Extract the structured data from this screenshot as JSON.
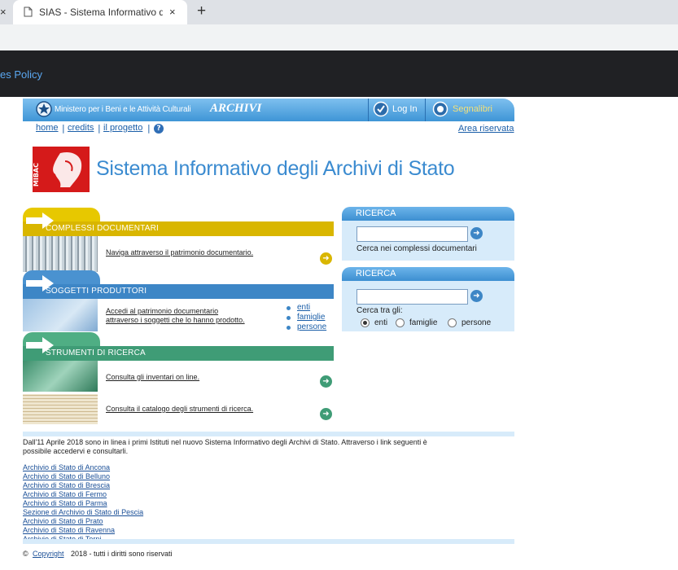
{
  "browser": {
    "close_left": "×",
    "tab_title": "SIAS - Sistema Informativo degli",
    "tab_close": "×",
    "new_tab": "+",
    "banner_text": "es Policy"
  },
  "header": {
    "ministry": "Ministero per i Beni e le Attività Culturali",
    "archivi": "ARCHIVI",
    "login": "Log In",
    "bookmarks": "Segnalibri"
  },
  "subnav": {
    "home": "home",
    "credits": "credits",
    "progetto": "il progetto",
    "sep": "|",
    "help": "?",
    "reserved": "Area riservata"
  },
  "logo": {
    "mark": "MIBAC",
    "title": "Sistema Informativo degli Archivi di Stato"
  },
  "sections": {
    "complessi": {
      "title": "COMPLESSI DOCUMENTARI",
      "link": "Naviga attraverso il patrimonio documentario."
    },
    "soggetti": {
      "title": "SOGGETTI PRODUTTORI",
      "link1": "Accedi al patrimonio documentario",
      "link2": "attraverso i soggetti che lo hanno prodotto.",
      "sub": [
        "enti",
        "famiglie",
        "persone"
      ]
    },
    "strumenti": {
      "title": "STRUMENTI DI RICERCA",
      "link_inventari": "Consulta gli inventari on line.",
      "link_catalogo": "Consulta il catalogo degli strumenti di ricerca."
    }
  },
  "search1": {
    "title": "RICERCA",
    "value": "",
    "caption": "Cerca nei complessi documentari"
  },
  "search2": {
    "title": "RICERCA",
    "value": "",
    "caption": "Cerca tra gli:",
    "options": [
      "enti",
      "famiglie",
      "persone"
    ],
    "selected": "enti"
  },
  "notice": {
    "line1": "Dall'11 Aprile 2018 sono in linea i primi Istituti nel nuovo Sistema Informativo degli Archivi di Stato. Attraverso i link seguenti è",
    "line2": "possibile accedervi e consultarli."
  },
  "archives": [
    "Archivio di Stato di Ancona",
    "Archivio di Stato di Belluno",
    "Archivio di Stato di Brescia",
    "Archivio di Stato di Fermo",
    "Archivio di Stato di Parma",
    "Sezione di Archivio di Stato di Pescia",
    "Archivio di Stato di Prato",
    "Archivio di Stato di Ravenna",
    "Archivio di Stato di Terni"
  ],
  "footer": {
    "symbol": "©",
    "copyright_link": "Copyright",
    "rest": "2018 - tutti i diritti sono riservati"
  },
  "colors": {
    "complessi": "#d9b600",
    "soggetti": "#3d86c6",
    "strumenti": "#3f9c76",
    "banner": "#202124"
  }
}
